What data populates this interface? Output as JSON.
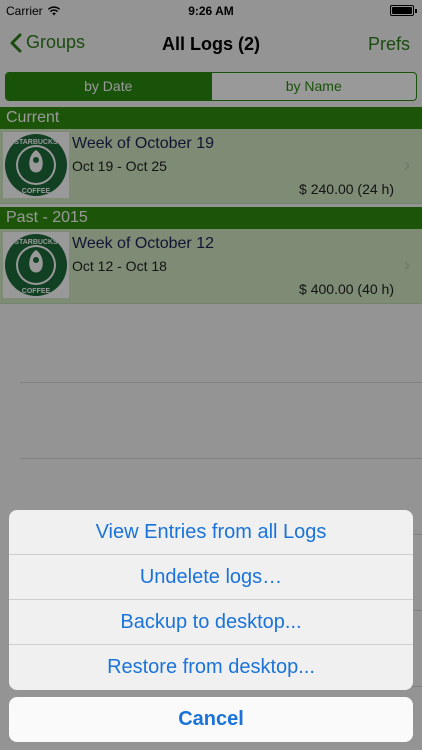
{
  "status_bar": {
    "carrier": "Carrier",
    "time": "9:26 AM"
  },
  "nav": {
    "back_label": "Groups",
    "title": "All Logs (2)",
    "prefs_label": "Prefs"
  },
  "segments": [
    {
      "label": "by Date",
      "selected": true
    },
    {
      "label": "by Name",
      "selected": false
    }
  ],
  "sections": [
    {
      "header": "Current",
      "logs": [
        {
          "title": "Week of October 19",
          "range": "Oct 19 - Oct 25",
          "amount": "$ 240.00 (24 h)"
        }
      ]
    },
    {
      "header": "Past - 2015",
      "logs": [
        {
          "title": "Week of October 12",
          "range": "Oct 12 - Oct 18",
          "amount": "$ 400.00 (40 h)"
        }
      ]
    }
  ],
  "logo": {
    "text_top": "STARBUCKS",
    "text_bottom": "COFFEE"
  },
  "colors": {
    "accent_green": "#2f8e10",
    "row_tint": "#d2e8c4",
    "action_blue": "#1a73d9"
  },
  "action_sheet": {
    "items": [
      "View Entries from all Logs",
      "Undelete logs…",
      "Backup to desktop...",
      "Restore from desktop..."
    ],
    "cancel": "Cancel"
  }
}
